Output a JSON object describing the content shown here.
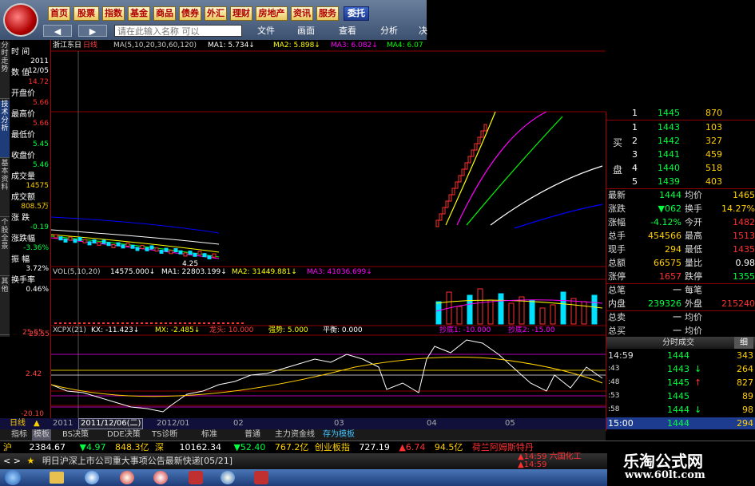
{
  "nav": {
    "items": [
      "首页",
      "股票",
      "指数",
      "基金",
      "商品",
      "债券",
      "外汇",
      "理财",
      "房地产",
      "资讯",
      "服务"
    ],
    "active": "委托"
  },
  "toolbar": {
    "search_placeholder": "请在此输入名称   可以",
    "file": "文件",
    "screen": "画面",
    "view": "查看",
    "analysis": "分析",
    "extra": "决"
  },
  "chart": {
    "stock_title": "浙江东日",
    "period": "日线",
    "ma_legend": "MA(5,10,20,30,60,120)",
    "ma1": "MA1: 5.734↓",
    "ma2": "MA2: 5.898↓",
    "ma3": "MA3: 6.082↓",
    "ma4": "MA4: 6.07",
    "low_marker": "4.25",
    "vol_legend": "VOL(5,10,20)",
    "vol_value": "14575.000↓",
    "vol_ma1": "MA1: 22803.199↓",
    "vol_ma2": "MA2: 31449.881↓",
    "vol_ma3": "MA3: 41036.699↓",
    "ind_legend": "XCPX(21)",
    "ind_kx": "KX: -11.423↓",
    "ind_mx": "MX: -2.485↓",
    "ind_long": "龙头: 10.000",
    "ind_strong": "强势: 5.000",
    "ind_flat": "平衡: 0.000",
    "ind_bottom": "抄底1: -10.000",
    "ind_bottom2": "抄底2: -15.00",
    "axis_top": "25.55",
    "axis_mid": "2.42",
    "axis_bot": "-20.10"
  },
  "left_panel": {
    "vtabs": [
      "分时走势",
      "技术分析",
      "基本资料",
      "个股全景",
      "其他"
    ],
    "rows": [
      {
        "label": "时  间",
        "value": "2011",
        "value2": "12/05"
      },
      {
        "label": "数  值",
        "value": "14.72"
      },
      {
        "label": "开盘价",
        "value": "5.66"
      },
      {
        "label": "最高价",
        "value": "5.66"
      },
      {
        "label": "最低价",
        "value": "5.45"
      },
      {
        "label": "收盘价",
        "value": "5.46"
      },
      {
        "label": "成交量",
        "value": "14575"
      },
      {
        "label": "成交额",
        "value": "808.5万"
      },
      {
        "label": "涨  跌",
        "value": "-0.19"
      },
      {
        "label": "涨跌幅",
        "value": "-3.36%"
      },
      {
        "label": "振  幅",
        "value": "3.72%"
      },
      {
        "label": "换手率",
        "value": "0.46%"
      }
    ]
  },
  "orderbook": {
    "top_row": {
      "n": "1",
      "price": "1445",
      "vol": "870"
    },
    "bids_label_1": "买",
    "bids_label_2": "盘",
    "bids": [
      {
        "n": "1",
        "price": "1443",
        "vol": "103"
      },
      {
        "n": "2",
        "price": "1442",
        "vol": "327"
      },
      {
        "n": "3",
        "price": "1441",
        "vol": "459"
      },
      {
        "n": "4",
        "price": "1440",
        "vol": "518"
      },
      {
        "n": "5",
        "price": "1439",
        "vol": "403"
      }
    ]
  },
  "quote": {
    "rows": [
      {
        "l1": "最新",
        "v1": "1444",
        "l2": "均价",
        "v2": "1465"
      },
      {
        "l1": "涨跌",
        "v1": "▼062",
        "l2": "换手",
        "v2": "14.27%"
      },
      {
        "l1": "涨幅",
        "v1": "-4.12%",
        "l2": "今开",
        "v2": "1482"
      },
      {
        "l1": "总手",
        "v1": "454566",
        "l2": "最高",
        "v2": "1513"
      },
      {
        "l1": "现手",
        "v1": "294",
        "l2": "最低",
        "v2": "1435"
      },
      {
        "l1": "总额",
        "v1": "66575",
        "l2": "量比",
        "v2": "0.98"
      },
      {
        "l1": "涨停",
        "v1": "1657",
        "l2": "跌停",
        "v2": "1355"
      },
      {
        "l1": "总笔",
        "v1": "一",
        "l2": "每笔",
        "v2": ""
      },
      {
        "l1": "内盘",
        "v1": "239326",
        "l2": "外盘",
        "v2": "215240"
      },
      {
        "l1": "总卖",
        "v1": "一",
        "l2": "均价",
        "v2": ""
      },
      {
        "l1": "总买",
        "v1": "一",
        "l2": "均价",
        "v2": ""
      }
    ]
  },
  "trades": {
    "header": "分时成交",
    "header_btn": "细",
    "rows": [
      {
        "t": "14:59",
        "p": "1444",
        "a": "",
        "v": "343"
      },
      {
        "t": ":43",
        "p": "1443",
        "a": "↓",
        "v": "264"
      },
      {
        "t": ":48",
        "p": "1445",
        "a": "↑",
        "v": "827"
      },
      {
        "t": ":53",
        "p": "1445",
        "a": "",
        "v": "89"
      },
      {
        "t": ":58",
        "p": "1444",
        "a": "↓",
        "v": "98"
      },
      {
        "t": "15:00",
        "p": "1444",
        "a": "",
        "v": "294"
      }
    ]
  },
  "period_bar": {
    "items": [
      "2011",
      "2011/12/06(二)",
      "2012/01",
      "02",
      "03",
      "04",
      "05"
    ]
  },
  "tab_bar": {
    "period_label": "日线",
    "tabs": [
      "指标",
      "模板",
      "BS决策",
      "DDE决策",
      "TS诊断",
      "标准",
      "普通",
      "主力资金线",
      "存为模板"
    ]
  },
  "ticker1": {
    "sh_label": "沪",
    "sh_val": "2384.67",
    "sh_chg": "▼4.97",
    "sh_amt": "848.3亿",
    "sz_label": "深",
    "sz_val": "10162.34",
    "sz_chg": "▼52.40",
    "sz_amt": "767.2亿",
    "cy_label": "创业板指",
    "cy_val": "727.19",
    "cy_chg": "▲6.74",
    "cy_amt": "94.5亿",
    "extra": "荷兰阿姆斯特丹"
  },
  "ticker2": {
    "news": "明日沪深上市公司重大事项公告最新快递[05/21]",
    "t1": "▲14:59 六国化工",
    "t2": "▲14:59"
  },
  "watermark": {
    "title": "乐淘公式网",
    "url": "www.60lt.com"
  },
  "colors": {
    "up": "#ff3030",
    "down": "#00e0ff",
    "grid": "#8b0000",
    "ma1": "#ffffff",
    "ma2": "#ffff00",
    "ma3": "#ff00ff",
    "ma4": "#00ff00"
  }
}
